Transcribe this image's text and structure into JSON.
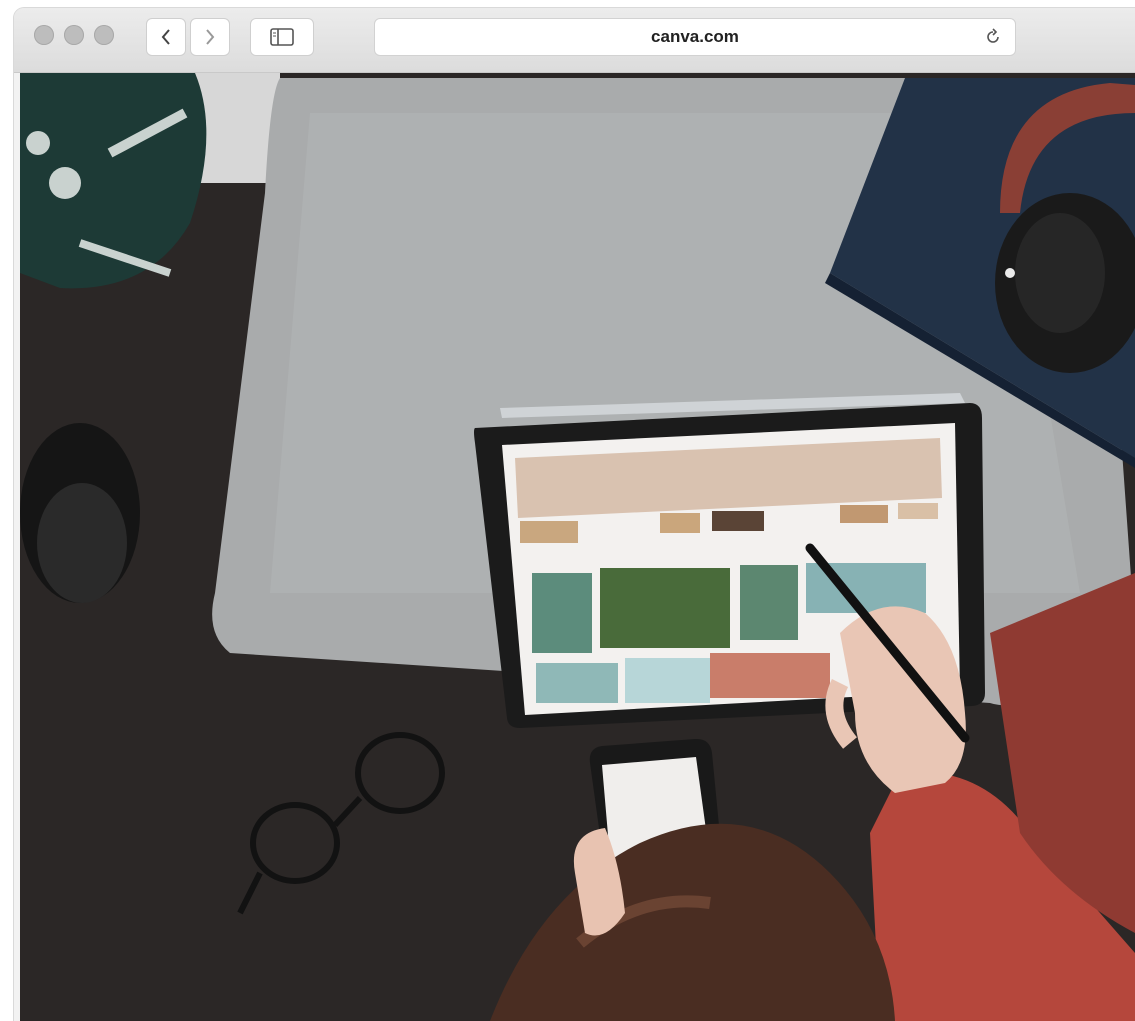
{
  "browser": {
    "address_bar": {
      "url": "canva.com"
    },
    "buttons": {
      "back": "back",
      "forward": "forward",
      "sidebar": "sidebar",
      "reload": "reload"
    },
    "icons": [
      "window-close-dot-icon",
      "window-minimize-dot-icon",
      "window-zoom-dot-icon",
      "chevron-left-icon",
      "chevron-right-icon",
      "sidebar-icon",
      "reload-icon"
    ]
  },
  "colors": {
    "toolbar": "#e3e3e3",
    "photo_background": "#2b2726",
    "pillow": "#a9abac",
    "notebook": "#223247",
    "sweater": "#b5473c"
  }
}
